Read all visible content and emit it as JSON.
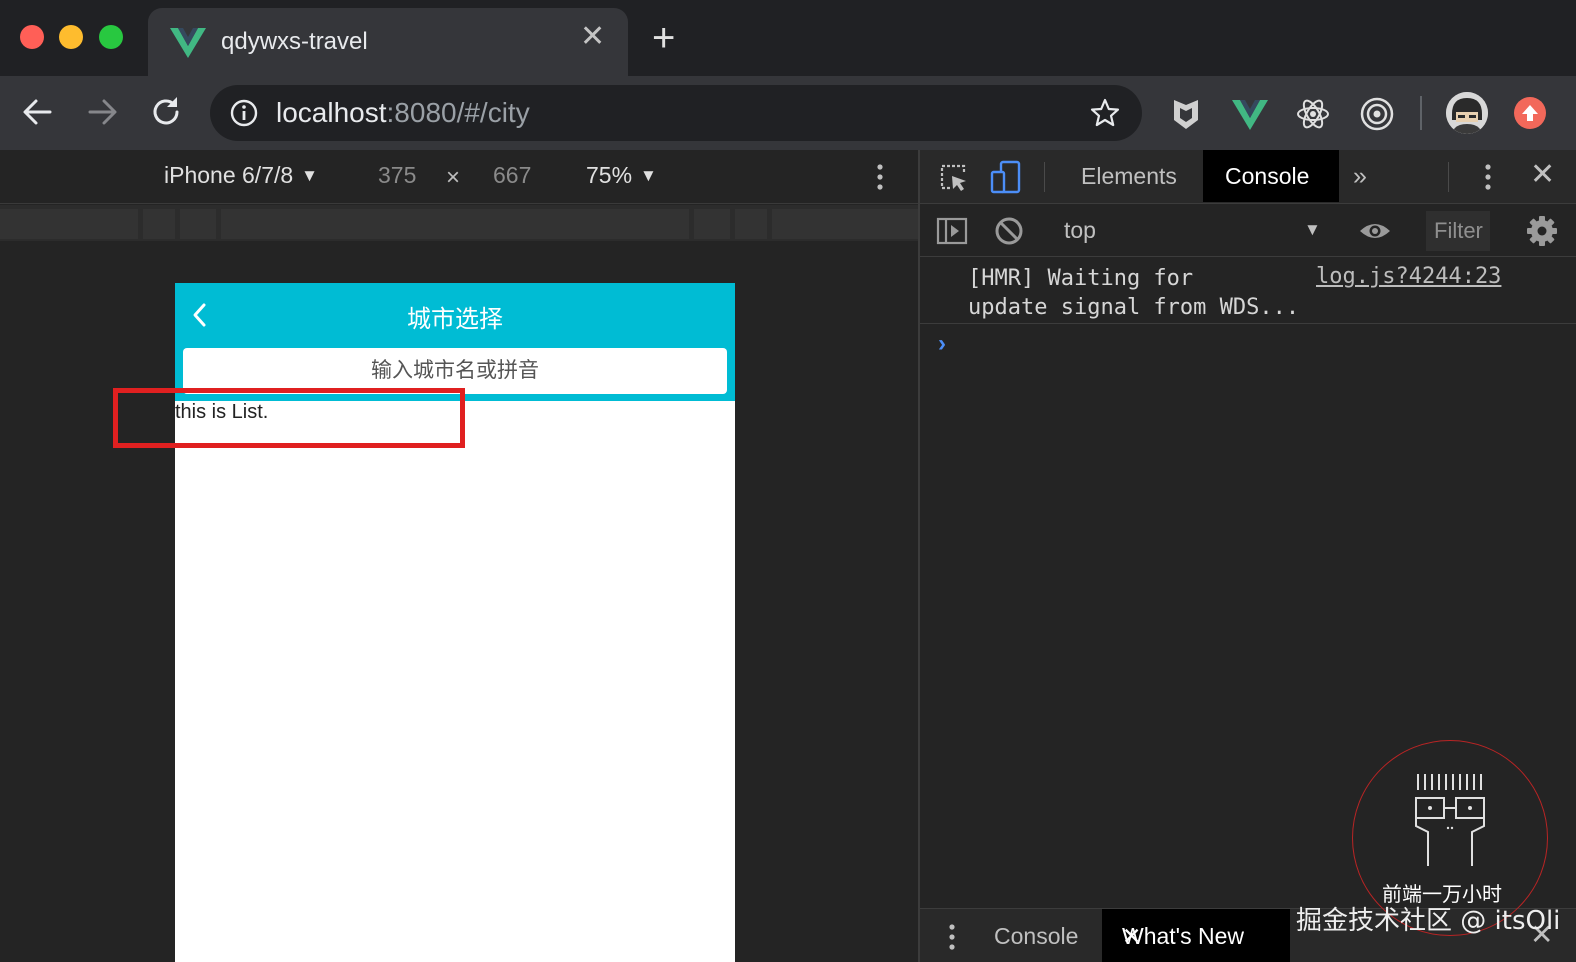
{
  "browser": {
    "tab_title": "qdywxs-travel",
    "tab_close": "✕",
    "new_tab": "+",
    "url_host": "localhost",
    "url_rest": ":8080/#/city"
  },
  "device_toolbar": {
    "device": "iPhone 6/7/8",
    "width": "375",
    "times": "×",
    "height": "667",
    "zoom": "75%"
  },
  "page": {
    "header_title": "城市选择",
    "search_placeholder": "输入城市名或拼音",
    "list_text": "this is List."
  },
  "devtools": {
    "tab_elements": "Elements",
    "tab_console": "Console",
    "tab_more": "»",
    "close": "✕",
    "context": "top",
    "filter_placeholder": "Filter",
    "log": {
      "line1": "[HMR] Waiting for",
      "line2": "update signal from WDS...",
      "source": "log.js?4244:23"
    },
    "prompt": "›",
    "drawer": {
      "console": "Console",
      "whats_new": "What's New",
      "whats_new_close": "✕",
      "close": "✕"
    }
  },
  "watermark": {
    "name": "前端一万小时",
    "credit": "掘金技术社区 @ itsOli"
  },
  "colors": {
    "header": "#00bcd4",
    "highlight": "#e02020",
    "accent_vue": "#41b883"
  }
}
